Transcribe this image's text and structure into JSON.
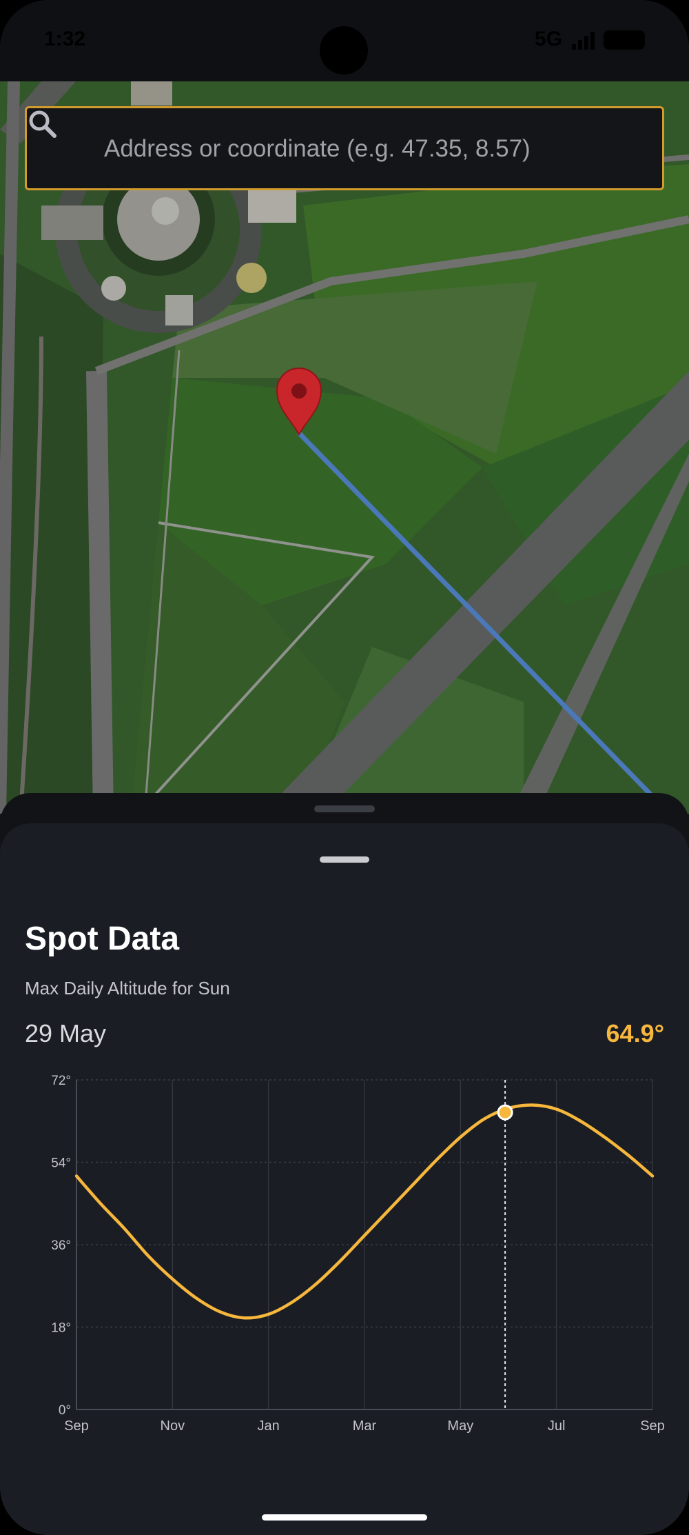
{
  "status_bar": {
    "time": "1:32",
    "network": "5G"
  },
  "search": {
    "placeholder": "Address or coordinate (e.g. 47.35, 8.57)",
    "value": ""
  },
  "sheet": {
    "title": "Spot Data",
    "subtitle": "Max Daily Altitude for Sun",
    "selected_date": "29 May",
    "selected_value": "64.9°"
  },
  "colors": {
    "accent": "#f6b73c",
    "search_border": "#d29b2c",
    "marker": "#c62828",
    "direction_line": "#4a78b8"
  },
  "chart_data": {
    "type": "line",
    "title": "",
    "xlabel": "",
    "ylabel": "",
    "x_ticks": [
      "Sep",
      "Nov",
      "Jan",
      "Mar",
      "May",
      "Jul",
      "Sep"
    ],
    "y_ticks": [
      "0°",
      "18°",
      "36°",
      "54°",
      "72°"
    ],
    "ylim": [
      0,
      72
    ],
    "grid": true,
    "x_months": [
      0,
      2,
      4,
      6,
      8,
      10,
      12
    ],
    "series": [
      {
        "x": [
          0,
          0.5,
          1,
          1.5,
          2,
          2.5,
          3,
          3.5,
          4,
          4.5,
          5,
          5.5,
          6,
          6.5,
          7,
          7.5,
          8,
          8.5,
          9,
          9.5,
          10,
          10.5,
          11,
          11.5,
          12
        ],
        "values": [
          51.0,
          45.0,
          39.5,
          33.5,
          28.5,
          24.3,
          21.3,
          20.0,
          20.8,
          23.5,
          27.5,
          32.5,
          38.0,
          43.5,
          49.0,
          54.5,
          59.5,
          63.5,
          65.8,
          66.5,
          65.6,
          63.0,
          59.5,
          55.5,
          51.0
        ]
      }
    ],
    "selected": {
      "x": 8.93,
      "value": 64.9,
      "label": "29 May"
    }
  }
}
